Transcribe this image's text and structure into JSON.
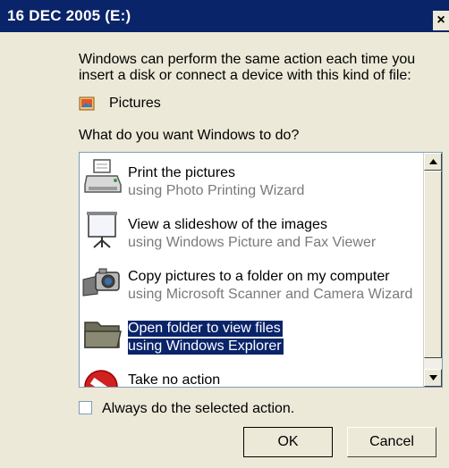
{
  "window": {
    "title": "16 DEC 2005 (E:)",
    "close_glyph": "×"
  },
  "intro": {
    "text": "Windows can perform the same action each time you insert a disk or connect a device with this kind of file:"
  },
  "filetype": {
    "label": "Pictures",
    "icon": "pictures-icon"
  },
  "question": "What do you want Windows to do?",
  "actions": [
    {
      "title": "Print the pictures",
      "subtitle": "using Photo Printing Wizard",
      "icon": "printer-icon",
      "selected": false
    },
    {
      "title": "View a slideshow of the images",
      "subtitle": "using Windows Picture and Fax Viewer",
      "icon": "projector-screen-icon",
      "selected": false
    },
    {
      "title": "Copy pictures to a folder on my computer",
      "subtitle": "using Microsoft Scanner and Camera Wizard",
      "icon": "camera-icon",
      "selected": false
    },
    {
      "title": "Open folder to view files",
      "subtitle": "using Windows Explorer",
      "icon": "folder-icon",
      "selected": true
    },
    {
      "title": "Take no action",
      "subtitle": "",
      "icon": "no-action-icon",
      "selected": false
    }
  ],
  "always_checkbox": {
    "label": "Always do the selected action.",
    "checked": false
  },
  "buttons": {
    "ok": "OK",
    "cancel": "Cancel"
  },
  "colors": {
    "titlebar": "#0a246a",
    "dialog_bg": "#ece9d8",
    "selection": "#0a246a"
  }
}
